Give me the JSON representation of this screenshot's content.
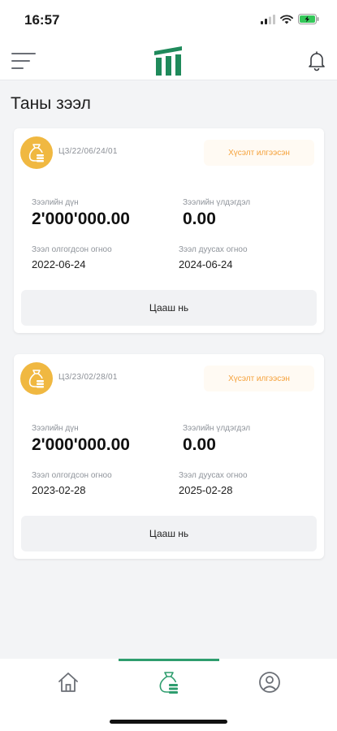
{
  "status_bar": {
    "time": "16:57"
  },
  "page": {
    "title": "Таны зээл"
  },
  "loans": [
    {
      "code": "Ц3/22/06/24/01",
      "status": "Хүсэлт илгээсэн",
      "amount_label": "Зээлийн дүн",
      "amount": "2'000'000.00",
      "balance_label": "Зээлийн үлдэгдэл",
      "balance": "0.00",
      "issued_label": "Зээл олгогдсон огноо",
      "issued_date": "2022-06-24",
      "end_label": "Зээл дуусах огноо",
      "end_date": "2024-06-24",
      "button": "Цааш нь"
    },
    {
      "code": "Ц3/23/02/28/01",
      "status": "Хүсэлт илгээсэн",
      "amount_label": "Зээлийн дүн",
      "amount": "2'000'000.00",
      "balance_label": "Зээлийн үлдэгдэл",
      "balance": "0.00",
      "issued_label": "Зээл олгогдсон огноо",
      "issued_date": "2023-02-28",
      "end_label": "Зээл дуусах огноо",
      "end_date": "2025-02-28",
      "button": "Цааш нь"
    }
  ],
  "tabs": [
    {
      "icon": "home-icon",
      "active": false
    },
    {
      "icon": "money-bag-icon",
      "active": true
    },
    {
      "icon": "profile-icon",
      "active": false
    }
  ],
  "colors": {
    "brand": "#1f8a5b",
    "accent_orange": "#f5a13a",
    "icon_yellow": "#f0b841",
    "tab_active": "#2e9d6e"
  }
}
